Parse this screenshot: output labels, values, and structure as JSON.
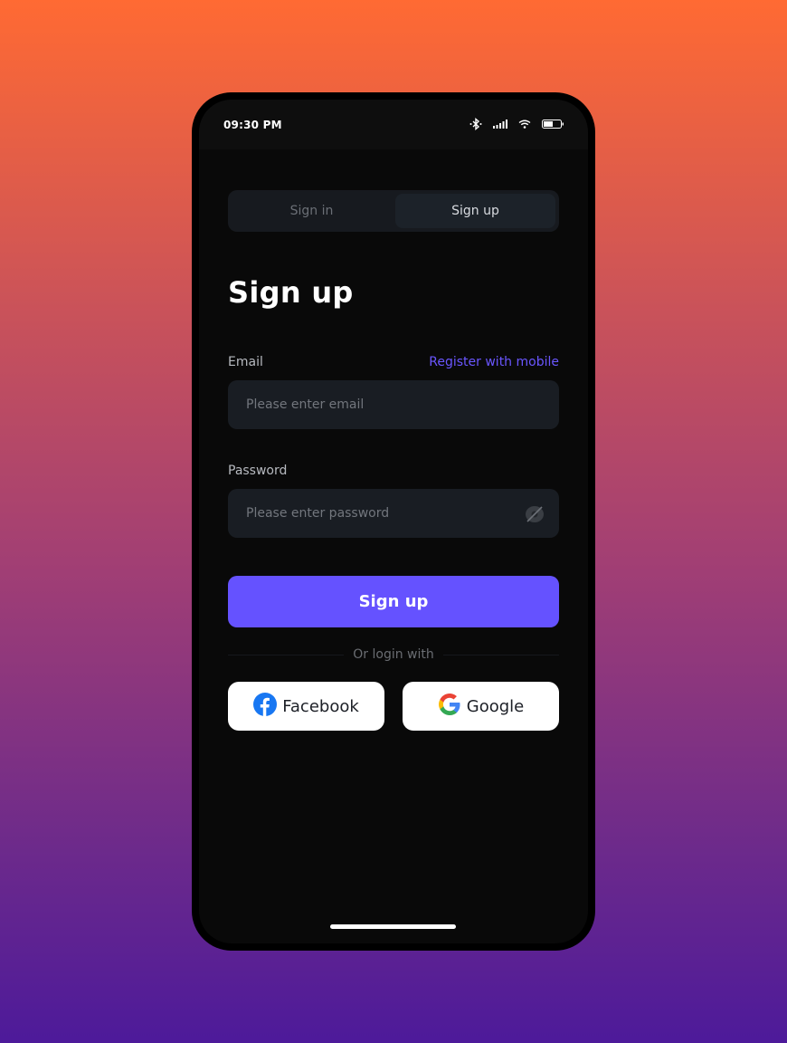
{
  "status_bar": {
    "time": "09:30 PM",
    "icons": [
      "bluetooth-icon",
      "signal-icon",
      "wifi-icon",
      "battery-icon"
    ]
  },
  "tabs": [
    {
      "label": "Sign in",
      "active": false
    },
    {
      "label": "Sign up",
      "active": true
    }
  ],
  "page_title": "Sign up",
  "email": {
    "label": "Email",
    "alt_link": "Register with mobile",
    "value": "",
    "placeholder": "Please enter email"
  },
  "password": {
    "label": "Password",
    "value": "",
    "placeholder": "Please enter password",
    "toggle_icon": "eye-off-icon"
  },
  "submit_label": "Sign up",
  "divider_text": "Or login with",
  "social": [
    {
      "label": "Facebook",
      "icon": "facebook-icon"
    },
    {
      "label": "Google",
      "icon": "google-icon"
    }
  ],
  "colors": {
    "accent": "#6552ff",
    "link": "#6a56ff",
    "screen_bg": "#090909",
    "field_bg": "#191d23"
  }
}
